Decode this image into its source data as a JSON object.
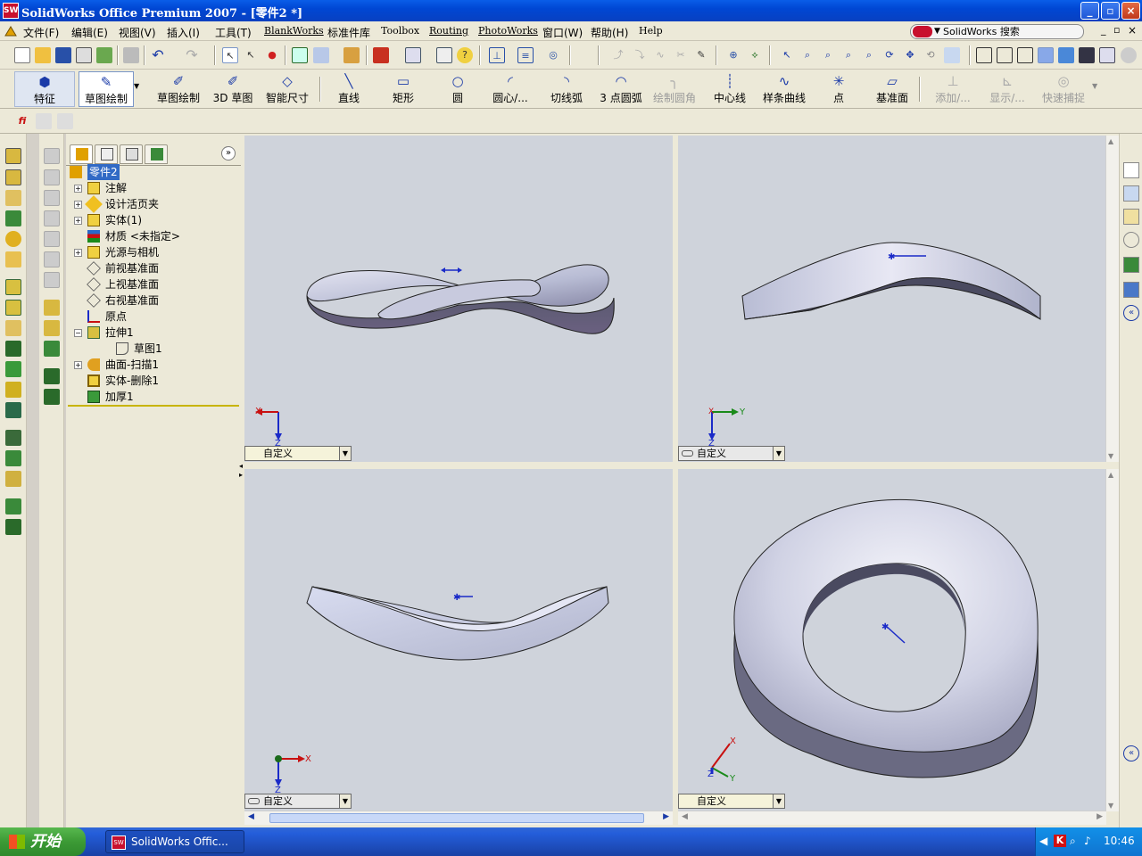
{
  "window": {
    "title": "SolidWorks Office Premium 2007 - [零件2 *]",
    "app_icon": "sw-logo-icon",
    "buttons": [
      "_",
      "▫",
      "×"
    ]
  },
  "menu": {
    "items": [
      "文件(F)",
      "编辑(E)",
      "视图(V)",
      "插入(I)",
      "工具(T)",
      "BlankWorks",
      "标准件库",
      "Toolbox",
      "Routing",
      "PhotoWorks",
      "窗口(W)",
      "帮助(H)",
      "Help"
    ],
    "search_placeholder": "SolidWorks 搜索"
  },
  "command_manager": {
    "buttons": [
      {
        "label": "特征",
        "icon": "features-icon"
      },
      {
        "label": "草图绘制",
        "icon": "sketch-icon"
      },
      {
        "label": "草图绘制",
        "icon": "sketch-draw-icon"
      },
      {
        "label": "3D 草图",
        "icon": "3d-sketch-icon"
      },
      {
        "label": "智能尺寸",
        "icon": "smart-dimension-icon"
      },
      {
        "label": "直线",
        "icon": "line-icon"
      },
      {
        "label": "矩形",
        "icon": "rectangle-icon"
      },
      {
        "label": "圆",
        "icon": "circle-icon"
      },
      {
        "label": "圆心/...",
        "icon": "center-arc-icon"
      },
      {
        "label": "切线弧",
        "icon": "tangent-arc-icon"
      },
      {
        "label": "3 点圆弧",
        "icon": "three-point-arc-icon"
      },
      {
        "label": "绘制圆角",
        "icon": "sketch-fillet-icon",
        "disabled": true
      },
      {
        "label": "中心线",
        "icon": "centerline-icon"
      },
      {
        "label": "样条曲线",
        "icon": "spline-icon"
      },
      {
        "label": "点",
        "icon": "point-icon"
      },
      {
        "label": "基准面",
        "icon": "plane-icon"
      },
      {
        "label": "添加/...",
        "icon": "add-relation-icon",
        "disabled": true
      },
      {
        "label": "显示/...",
        "icon": "display-relation-icon",
        "disabled": true
      },
      {
        "label": "快速捕捉",
        "icon": "quick-snap-icon",
        "disabled": true
      }
    ]
  },
  "feature_tree": {
    "root": "零件2",
    "items": [
      {
        "label": "注解",
        "icon": "annotations-icon",
        "expand": "+"
      },
      {
        "label": "设计活页夹",
        "icon": "design-binder-icon",
        "expand": "+"
      },
      {
        "label": "实体(1)",
        "icon": "solid-bodies-icon",
        "expand": "+"
      },
      {
        "label": "材质 <未指定>",
        "icon": "material-icon",
        "expand": ""
      },
      {
        "label": "光源与相机",
        "icon": "lights-cameras-icon",
        "expand": "+"
      },
      {
        "label": "前视基准面",
        "icon": "plane-icon",
        "expand": ""
      },
      {
        "label": "上视基准面",
        "icon": "plane-icon",
        "expand": ""
      },
      {
        "label": "右视基准面",
        "icon": "plane-icon",
        "expand": ""
      },
      {
        "label": "原点",
        "icon": "origin-icon",
        "expand": ""
      },
      {
        "label": "拉伸1",
        "icon": "extrude-icon",
        "expand": "−"
      },
      {
        "label": "草图1",
        "icon": "sketch-icon",
        "expand": "",
        "child": true
      },
      {
        "label": "曲面-扫描1",
        "icon": "surface-sweep-icon",
        "expand": "+"
      },
      {
        "label": "实体-删除1",
        "icon": "delete-body-icon",
        "expand": ""
      },
      {
        "label": "加厚1",
        "icon": "thicken-icon",
        "expand": ""
      }
    ]
  },
  "viewports": [
    {
      "view": "自定义",
      "axes": [
        "X",
        "Z"
      ]
    },
    {
      "view": "自定义",
      "axes": [
        "X",
        "Y",
        "Z"
      ]
    },
    {
      "view": "自定义",
      "axes": [
        "X",
        "Z"
      ]
    },
    {
      "view": "自定义",
      "axes": [
        "X",
        "Y",
        "Z"
      ]
    }
  ],
  "taskbar": {
    "start": "开始",
    "task": "SolidWorks Offic...",
    "clock": "10:46"
  },
  "colors": {
    "viewport_bg": "#cfd3db",
    "titlebar": "#0a5de8",
    "taskbar": "#245edb"
  }
}
